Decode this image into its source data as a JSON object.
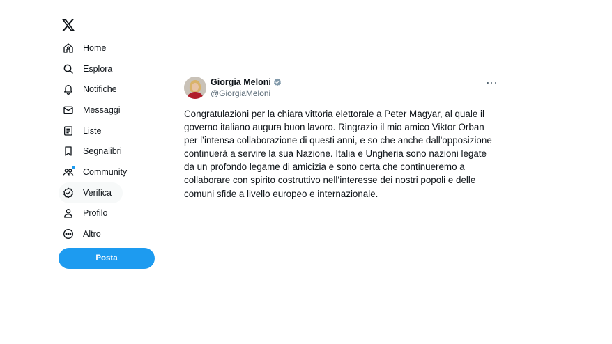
{
  "nav": {
    "items": [
      {
        "label": "Home",
        "icon": "home-icon"
      },
      {
        "label": "Esplora",
        "icon": "search-icon"
      },
      {
        "label": "Notifiche",
        "icon": "bell-icon"
      },
      {
        "label": "Messaggi",
        "icon": "envelope-icon"
      },
      {
        "label": "Liste",
        "icon": "list-icon"
      },
      {
        "label": "Segnalibri",
        "icon": "bookmark-icon"
      },
      {
        "label": "Community",
        "icon": "people-icon"
      },
      {
        "label": "Verifica",
        "icon": "verified-badge-icon"
      },
      {
        "label": "Profilo",
        "icon": "person-icon"
      },
      {
        "label": "Altro",
        "icon": "more-circle-icon"
      }
    ],
    "post_label": "Posta"
  },
  "tweet": {
    "display_name": "Giorgia Meloni",
    "handle": "@GiorgiaMeloni",
    "text": "Congratulazioni per la chiara vittoria elettorale a Peter Magyar, al quale il governo italiano augura buon lavoro. Ringrazio il mio amico Viktor Orban per l’intensa collaborazione di questi anni, e so che anche dall'opposizione continuerà a servire la sua Nazione. Italia e Ungheria sono nazioni legate da un profondo legame di amicizia e sono certa che continueremo a collaborare con spirito costruttivo nell’interesse dei nostri popoli e delle comuni sfide a livello europeo e internazionale."
  },
  "colors": {
    "accent": "#1d9bf0",
    "text": "#0f1419",
    "secondary": "#536471"
  }
}
